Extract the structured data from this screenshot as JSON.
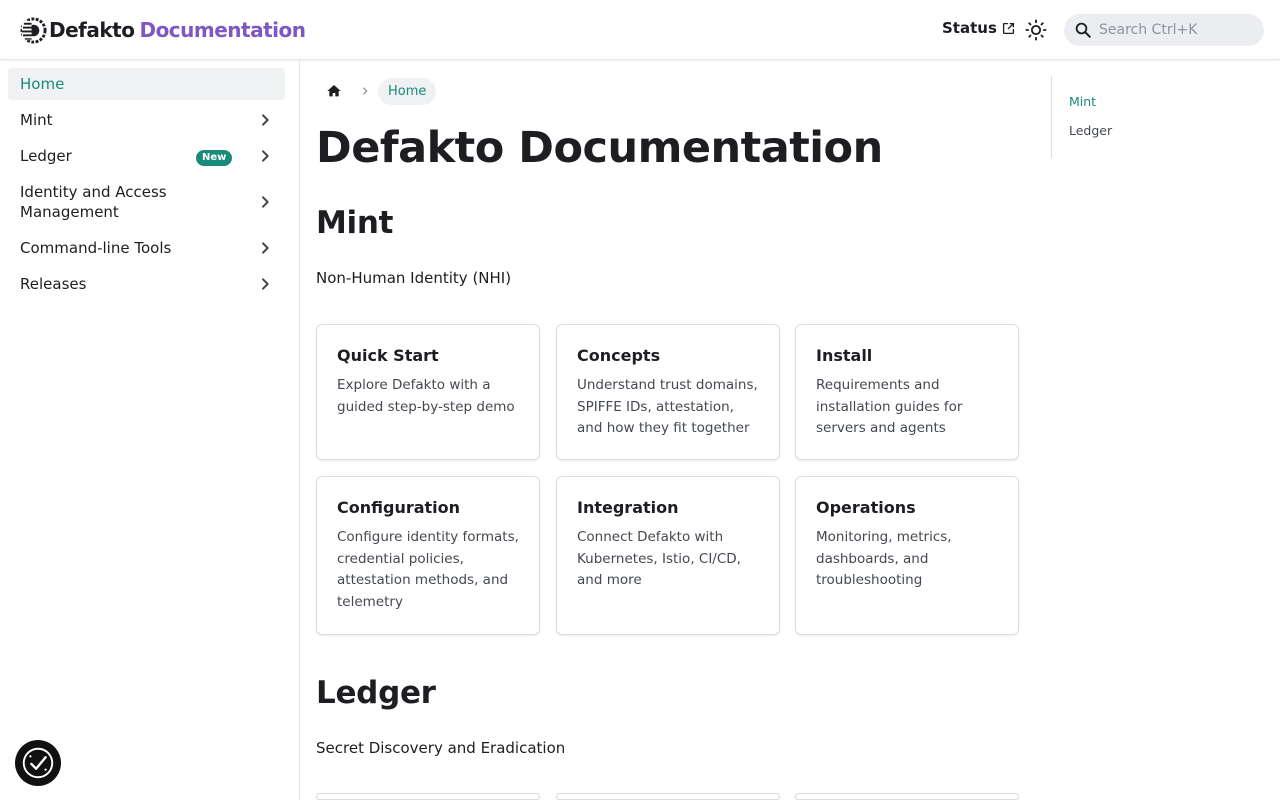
{
  "navbar": {
    "brand_name": "Defakto",
    "brand_sub": "Documentation",
    "status_link": "Status",
    "search_placeholder": "Search Ctrl+K",
    "colors": {
      "brand_sub": "#7e57c2",
      "accent": "#1a8a7a"
    }
  },
  "sidebar": {
    "items": [
      {
        "label": "Home",
        "active": true
      },
      {
        "label": "Mint",
        "expandable": true
      },
      {
        "label": "Ledger",
        "badge": "New",
        "expandable": true
      },
      {
        "label": "Identity and Access Management",
        "expandable": true
      },
      {
        "label": "Command-line Tools",
        "expandable": true
      },
      {
        "label": "Releases",
        "expandable": true
      }
    ]
  },
  "breadcrumb": {
    "current": "Home"
  },
  "main": {
    "title": "Defakto Documentation",
    "sections": [
      {
        "title": "Mint",
        "subtitle": "Non-Human Identity (NHI)",
        "cards": [
          {
            "title": "Quick Start",
            "desc": "Explore Defakto with a guided step-by-step demo"
          },
          {
            "title": "Concepts",
            "desc": "Understand trust domains, SPIFFE IDs, attestation, and how they fit together"
          },
          {
            "title": "Install",
            "desc": "Requirements and installation guides for servers and agents"
          },
          {
            "title": "Configuration",
            "desc": "Configure identity formats, credential policies, attestation methods, and telemetry"
          },
          {
            "title": "Integration",
            "desc": "Connect Defakto with Kubernetes, Istio, CI/CD, and more"
          },
          {
            "title": "Operations",
            "desc": "Monitoring, metrics, dashboards, and troubleshooting"
          }
        ]
      },
      {
        "title": "Ledger",
        "subtitle": "Secret Discovery and Eradication"
      }
    ]
  },
  "toc": {
    "items": [
      {
        "label": "Mint",
        "active": true
      },
      {
        "label": "Ledger"
      }
    ]
  }
}
